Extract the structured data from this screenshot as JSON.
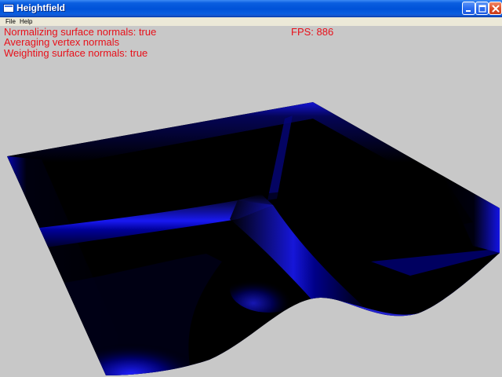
{
  "window": {
    "title": "Heightfield",
    "title_bar_color": "#0052d8"
  },
  "title_bar_buttons": [
    {
      "name": "minimize",
      "icon": "minimize-icon"
    },
    {
      "name": "maximize",
      "icon": "maximize-icon"
    },
    {
      "name": "close",
      "icon": "close-icon"
    }
  ],
  "menu": {
    "items": [
      {
        "label": "File"
      },
      {
        "label": "Help"
      }
    ]
  },
  "overlay": {
    "text_color": "#e8101a",
    "lines": [
      "Normalizing surface normals: true",
      "Averaging vertex normals",
      "Weighting surface normals: true"
    ],
    "fps": "FPS: 886"
  },
  "scene": {
    "background_color": "#c8c8c8",
    "surface_color": "#0000ff",
    "shadow_color": "#000000"
  }
}
